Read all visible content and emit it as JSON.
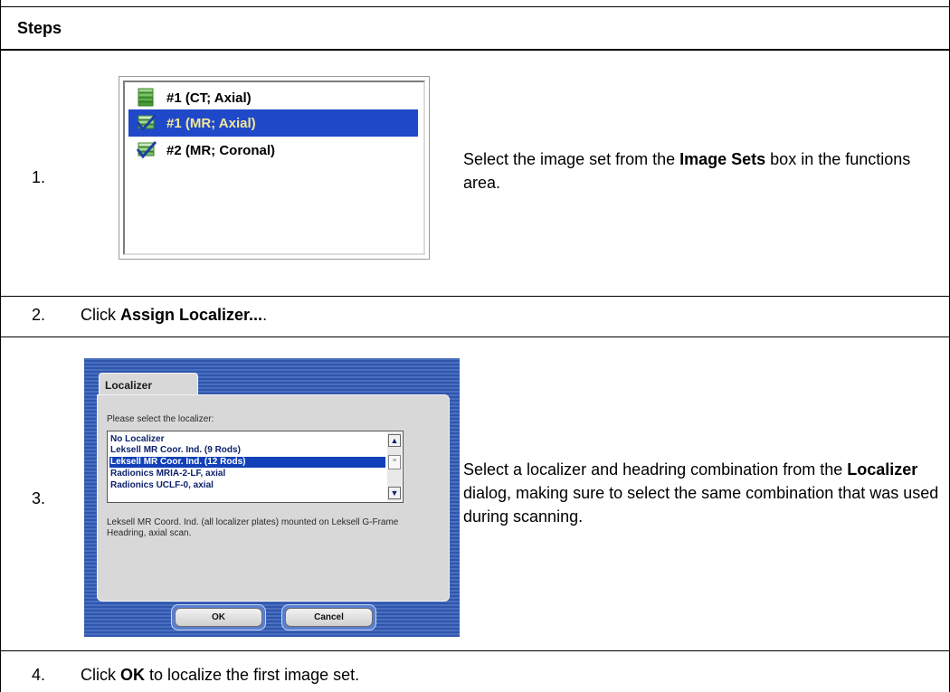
{
  "header": {
    "title": "Steps"
  },
  "steps": [
    {
      "num": "1.",
      "text_prefix": "Select the image set from the ",
      "bold": "Image Sets",
      "text_suffix": " box in the functions area."
    },
    {
      "num": "2.",
      "text_prefix": "Click ",
      "bold": "Assign Localizer...",
      "text_suffix": "."
    },
    {
      "num": "3.",
      "text_prefix": "Select a localizer and headring combination from the ",
      "bold": "Localizer",
      "text_suffix": " dialog, making sure to select the same combination that was used during scanning."
    },
    {
      "num": "4.",
      "text_prefix": "Click ",
      "bold": "OK",
      "text_suffix": " to localize the first image set."
    }
  ],
  "image_sets": {
    "items": [
      {
        "label": "#1 (CT; Axial)",
        "icon": "ct-stack-icon",
        "selected": false
      },
      {
        "label": "#1 (MR; Axial)",
        "icon": "checked-stack-icon",
        "selected": true
      },
      {
        "label": "#2 (MR; Coronal)",
        "icon": "checked-stack-icon",
        "selected": false
      }
    ]
  },
  "localizer_dialog": {
    "tab_label": "Localizer",
    "prompt": "Please select the localizer:",
    "items": [
      {
        "label": "No Localizer",
        "selected": false
      },
      {
        "label": "Leksell MR Coor. Ind. (9 Rods)",
        "selected": false
      },
      {
        "label": "Leksell MR Coor. Ind. (12 Rods)",
        "selected": true
      },
      {
        "label": "Radionics MRIA-2-LF, axial",
        "selected": false
      },
      {
        "label": "Radionics UCLF-0, axial",
        "selected": false
      }
    ],
    "description": "Leksell MR Coord. Ind. (all localizer plates) mounted on Leksell G-Frame Headring, axial scan.",
    "ok_label": "OK",
    "cancel_label": "Cancel",
    "scroll_up": "▲",
    "scroll_down": "▼",
    "scroll_thumb": "≡"
  },
  "colors": {
    "selection_blue": "#1f49c9",
    "dialog_blue": "#2e56ad"
  }
}
